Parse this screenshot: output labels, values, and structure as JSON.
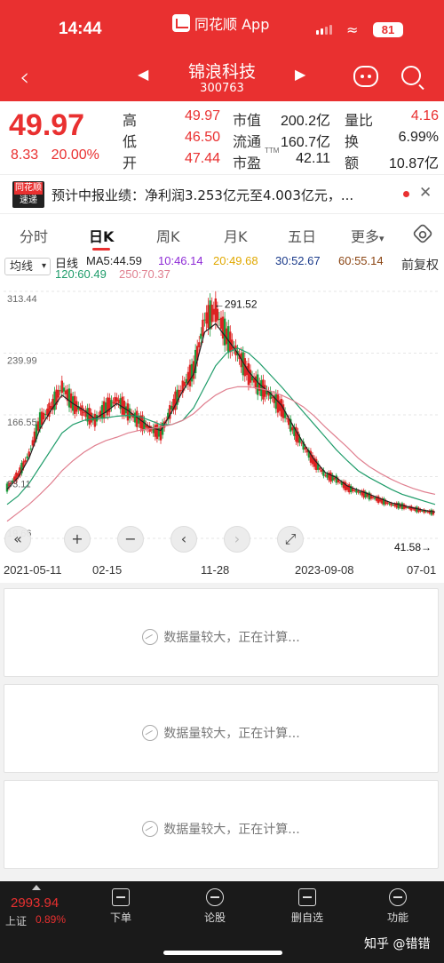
{
  "status_bar": {
    "time": "14:44",
    "app_name": "同花顺 App",
    "battery": "81"
  },
  "header": {
    "stock_name": "锦浪科技",
    "stock_code": "300763"
  },
  "quote": {
    "price": "49.97",
    "change": "8.33",
    "change_pct": "20.00%",
    "high_label": "高",
    "high": "49.97",
    "low_label": "低",
    "low": "46.50",
    "open_label": "开",
    "open": "47.44",
    "mcap_label": "市值",
    "mcap": "200.2亿",
    "float_label": "流通",
    "float": "160.7亿",
    "pe_label": "市盈",
    "pe_sup": "TTM",
    "pe": "42.11",
    "vol_ratio_label": "量比",
    "vol_ratio": "4.16",
    "turnover_label": "换",
    "turnover": "6.99%",
    "amount_label": "额",
    "amount": "10.87亿"
  },
  "news": {
    "badge_top": "同花顺",
    "badge_bottom": "速递",
    "text": "预计中报业绩：净利润3.253亿元至4.003亿元，..."
  },
  "tabs": [
    "分时",
    "日K",
    "周K",
    "月K",
    "五日",
    "更多"
  ],
  "active_tab": "日K",
  "ma_bar": {
    "selector": "均线",
    "label": "日线",
    "fuquan": "前复权",
    "items": [
      {
        "text": "MA5:44.59",
        "color": "#222222"
      },
      {
        "text": "10:46.14",
        "color": "#8e2bd6"
      },
      {
        "text": "20:49.68",
        "color": "#e0a800"
      },
      {
        "text": "30:52.67",
        "color": "#1a3a8a"
      },
      {
        "text": "60:55.14",
        "color": "#8b4513"
      },
      {
        "text": "120:60.49",
        "color": "#1f9c6a"
      },
      {
        "text": "250:70.37",
        "color": "#e08090"
      }
    ]
  },
  "chart_data": {
    "type": "line",
    "title": "",
    "y_ticks": [
      "313.44",
      "239.99",
      "166.55",
      "93.11",
      "19.66"
    ],
    "ylim": [
      19.66,
      313.44
    ],
    "x_ticks": [
      "2021-05-11",
      "02-15",
      "11-28",
      "2023-09-08",
      "07-01"
    ],
    "max_marker": "291.52",
    "min_marker": "41.58",
    "series": [
      {
        "color": "#c03030",
        "values": [
          80,
          95,
          120,
          160,
          175,
          200,
          180,
          170,
          160,
          175,
          185,
          170,
          160,
          150,
          145,
          175,
          200,
          220,
          280,
          291,
          260,
          240,
          215,
          200,
          190,
          175,
          150,
          130,
          110,
          95,
          90,
          80,
          75,
          70,
          65,
          60,
          58,
          55,
          52,
          50
        ]
      },
      {
        "color": "#222222",
        "values": [
          78,
          92,
          115,
          150,
          172,
          190,
          180,
          172,
          162,
          170,
          180,
          172,
          162,
          152,
          148,
          170,
          195,
          215,
          265,
          275,
          258,
          240,
          218,
          203,
          192,
          178,
          155,
          133,
          113,
          98,
          92,
          82,
          77,
          72,
          67,
          62,
          59,
          56,
          53,
          51
        ]
      },
      {
        "color": "#1f9c6a",
        "values": [
          60,
          70,
          85,
          105,
          125,
          145,
          155,
          160,
          162,
          163,
          165,
          166,
          165,
          160,
          155,
          155,
          160,
          175,
          200,
          225,
          240,
          246,
          240,
          228,
          214,
          200,
          185,
          170,
          155,
          140,
          125,
          112,
          100,
          92,
          85,
          78,
          72,
          68,
          64,
          60
        ]
      },
      {
        "color": "#e08090",
        "values": [
          40,
          50,
          60,
          72,
          85,
          100,
          112,
          122,
          130,
          136,
          140,
          145,
          148,
          150,
          152,
          155,
          160,
          168,
          180,
          190,
          197,
          200,
          200,
          198,
          195,
          190,
          184,
          176,
          165,
          152,
          140,
          128,
          115,
          105,
          97,
          90,
          84,
          79,
          75,
          72
        ]
      }
    ]
  },
  "chart_controls": [
    "«",
    "+",
    "−",
    "‹",
    "›",
    "⤢"
  ],
  "panels": [
    "数据量较大，正在计算...",
    "数据量较大，正在计算...",
    "数据量较大，正在计算..."
  ],
  "bottom": {
    "index_value": "2993.94",
    "index_name": "上证",
    "index_pct": "0.89%",
    "buttons": [
      "下单",
      "论股",
      "删自选",
      "功能"
    ]
  },
  "watermark": "知乎 @错错"
}
